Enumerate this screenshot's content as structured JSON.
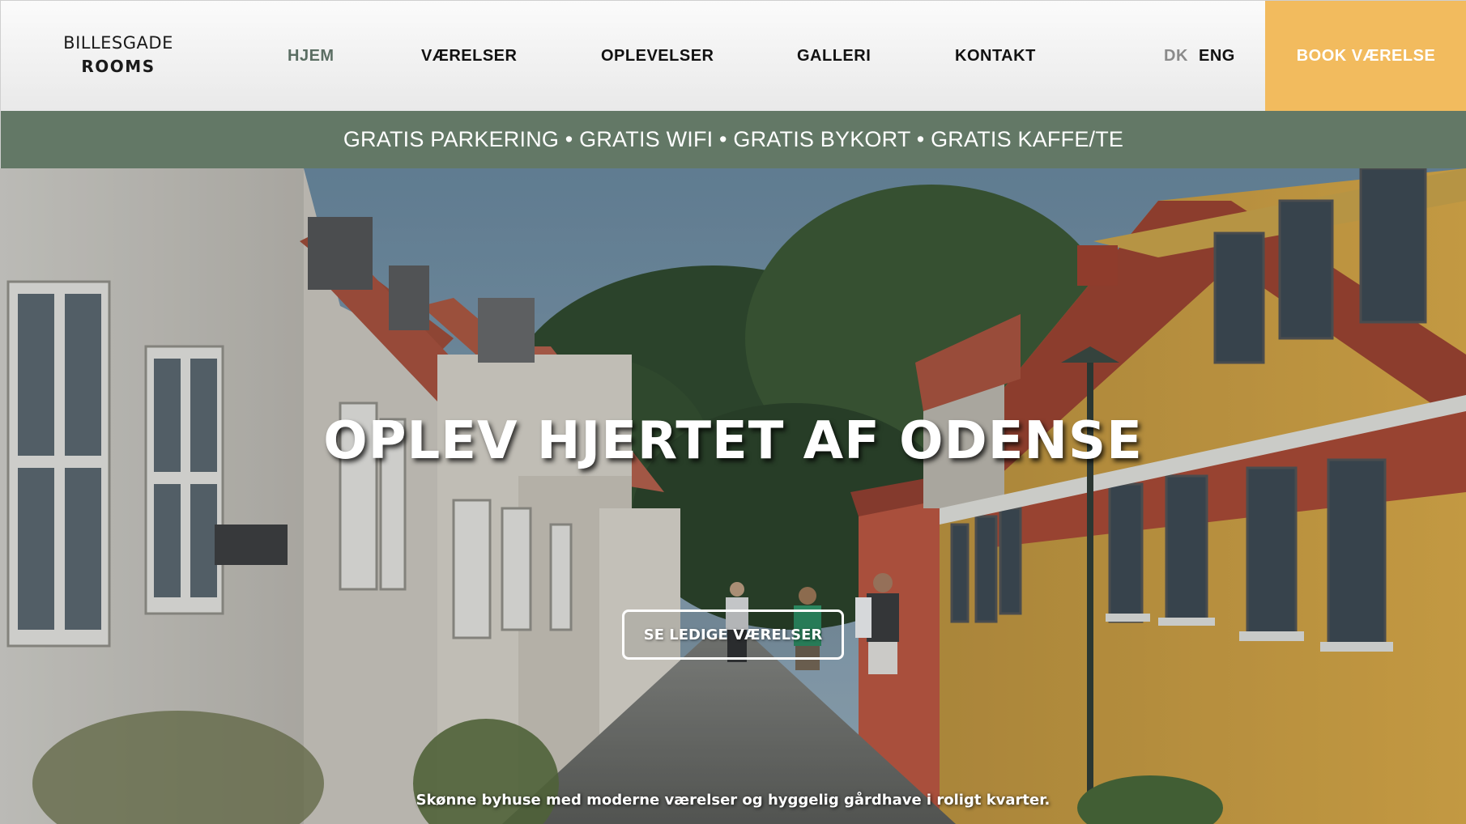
{
  "header": {
    "logo": {
      "line1": "BILLESGADE",
      "line2": "ROOMS"
    },
    "nav": [
      {
        "label": "HJEM",
        "active": true
      },
      {
        "label": "VÆRELSER",
        "active": false
      },
      {
        "label": "OPLEVELSER",
        "active": false
      },
      {
        "label": "GALLERI",
        "active": false
      },
      {
        "label": "KONTAKT",
        "active": false
      }
    ],
    "languages": {
      "dk": "DK",
      "eng": "ENG"
    },
    "book_button": "BOOK VÆRELSE"
  },
  "perks_bar": {
    "text": "GRATIS PARKERING • GRATIS WIFI • GRATIS BYKORT • GRATIS KAFFE/TE"
  },
  "hero": {
    "title": "OPLEV HJERTET AF ODENSE",
    "cta": "SE LEDIGE VÆRELSER",
    "subtitle": "Skønne byhuse med moderne værelser og hyggelig gårdhave i roligt kvarter."
  },
  "colors": {
    "accent_book": "#f2bb5e",
    "perks_bar": "#637866",
    "active_nav": "#5b6e63"
  }
}
